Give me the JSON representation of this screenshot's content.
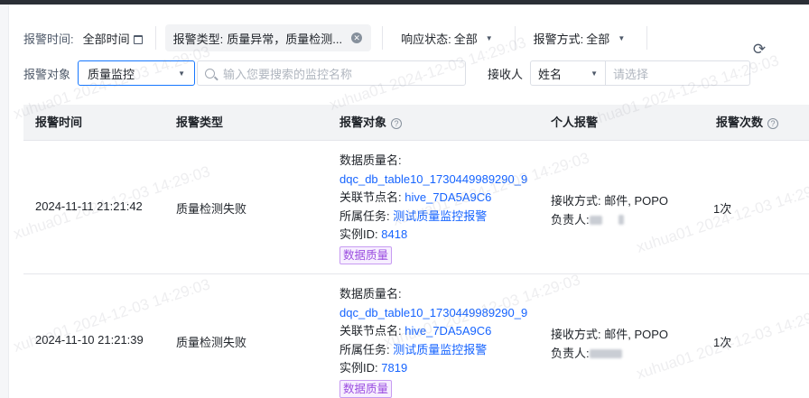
{
  "filters": {
    "alarm_time_label": "报警时间:",
    "alarm_time_value": "全部时间",
    "alarm_type_label": "报警类型:",
    "alarm_type_value": "质量异常，质量检测...",
    "response_label": "响应状态:",
    "response_value": "全部",
    "method_label": "报警方式:",
    "method_value": "全部",
    "object_label": "报警对象",
    "object_value": "质量监控",
    "search_placeholder": "输入您要搜索的监控名称",
    "receiver_label": "接收人",
    "receiver_field": "姓名",
    "receiver_placeholder": "请选择"
  },
  "table": {
    "headers": [
      "报警时间",
      "报警类型",
      "报警对象",
      "个人报警",
      "报警次数"
    ],
    "rows": [
      {
        "time": "2024-11-11 21:21:42",
        "type": "质量检测失败",
        "obj_name_label": "数据质量名:",
        "obj_name": "dqc_db_table10_1730449989290_9",
        "node_label": "关联节点名:",
        "node": "hive_7DA5A9C6",
        "task_label": "所属任务:",
        "task": "测试质量监控报警",
        "instance_label": "实例ID:",
        "instance": "8418",
        "tag": "数据质量",
        "receive_method": "接收方式: 邮件, POPO",
        "owner_label": "负责人:",
        "count": "1次"
      },
      {
        "time": "2024-11-10 21:21:39",
        "type": "质量检测失败",
        "obj_name_label": "数据质量名:",
        "obj_name": "dqc_db_table10_1730449989290_9",
        "node_label": "关联节点名:",
        "node": "hive_7DA5A9C6",
        "task_label": "所属任务:",
        "task": "测试质量监控报警",
        "instance_label": "实例ID:",
        "instance": "7819",
        "tag": "数据质量",
        "receive_method": "接收方式: 邮件, POPO",
        "owner_label": "负责人:",
        "count": "1次"
      }
    ]
  },
  "watermarks": [
    "xuhua01 2024-12-03 14:29:03"
  ],
  "colors": {
    "link": "#1664ff",
    "accent_border": "#1677ff",
    "tag_purple": "#9b4ee0",
    "header_bg": "#f2f3f5"
  }
}
